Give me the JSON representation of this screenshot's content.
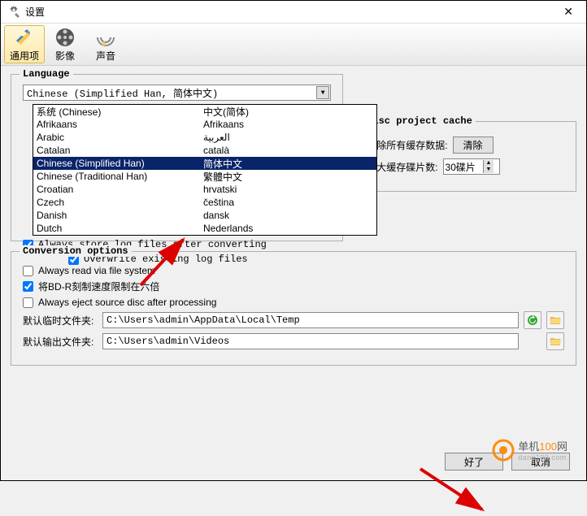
{
  "window": {
    "title": "设置"
  },
  "tabs": {
    "general": "通用项",
    "video": "影像",
    "audio": "声音"
  },
  "language": {
    "legend": "Language",
    "selected": "Chinese (Simplified Han, 简体中文)",
    "items": [
      {
        "name": "系统 (Chinese)",
        "native": "中文(简体)"
      },
      {
        "name": "Afrikaans",
        "native": "Afrikaans"
      },
      {
        "name": "Arabic",
        "native": "العربية"
      },
      {
        "name": "Catalan",
        "native": "català"
      },
      {
        "name": "Chinese (Simplified Han)",
        "native": "简体中文"
      },
      {
        "name": "Chinese (Traditional Han)",
        "native": "繁體中文"
      },
      {
        "name": "Croatian",
        "native": "hrvatski"
      },
      {
        "name": "Czech",
        "native": "čeština"
      },
      {
        "name": "Danish",
        "native": "dansk"
      },
      {
        "name": "Dutch",
        "native": "Nederlands"
      }
    ],
    "selected_index": 4
  },
  "log": {
    "always_store": "Always store log files after converting",
    "overwrite": "Overwrite existing log files"
  },
  "disc_cache": {
    "legend": "Disc project cache",
    "clear_label": "清除所有缓存数据:",
    "clear_btn": "清除",
    "max_label": "最大缓存碟片数:",
    "max_value": "30碟片"
  },
  "conversion": {
    "legend": "Conversion options",
    "read_fs": "Always read via file system",
    "bdr_limit": "将BD-R刻制速度限制在六倍",
    "eject": "Always eject source disc after processing",
    "temp_label": "默认临时文件夹:",
    "temp_value": "C:\\Users\\admin\\AppData\\Local\\Temp",
    "out_label": "默认输出文件夹:",
    "out_value": "C:\\Users\\admin\\Videos"
  },
  "footer": {
    "ok": "好了",
    "cancel": "取消"
  },
  "watermark": {
    "main": "单机100网",
    "sub": "danji100.com"
  }
}
